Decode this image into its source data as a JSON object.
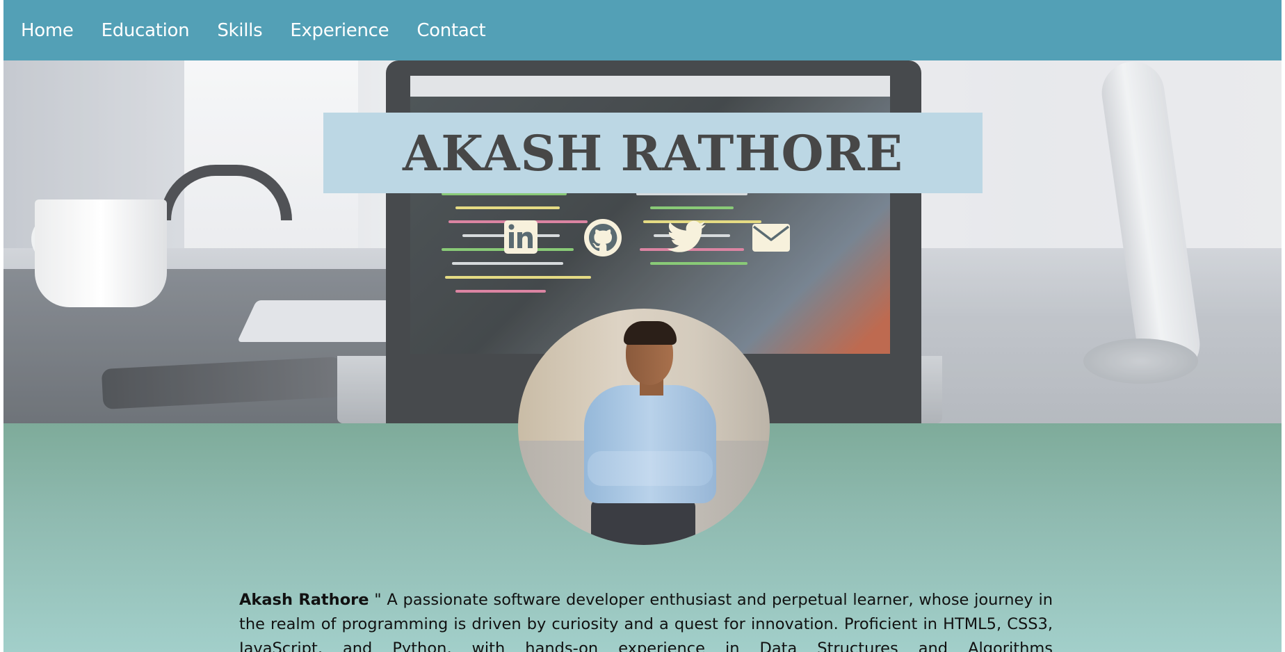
{
  "nav": {
    "items": [
      "Home",
      "Education",
      "Skills",
      "Experience",
      "Contact"
    ]
  },
  "hero": {
    "title": "AKASH RATHORE",
    "social": [
      {
        "name": "linkedin-icon",
        "color": "#f7f1dc"
      },
      {
        "name": "github-icon",
        "color": "#f7f1dc"
      },
      {
        "name": "twitter-icon",
        "color": "#f7f1dc"
      },
      {
        "name": "mail-icon",
        "color": "#f7f1dc"
      }
    ]
  },
  "about": {
    "name": "Akash Rathore",
    "text": " \" A passionate software developer enthusiast and perpetual learner, whose journey in the realm of programming is driven by curiosity and a quest for innovation. Proficient in HTML5, CSS3, JavaScript, and Python, with hands-on experience in Data Structures and Algorithms"
  },
  "colors": {
    "nav_bg": "#53a0b6",
    "title_bg": "#bcd7e4",
    "title_text": "#474747",
    "about_top": "#7eab9a",
    "about_bottom": "#a2cfca"
  }
}
